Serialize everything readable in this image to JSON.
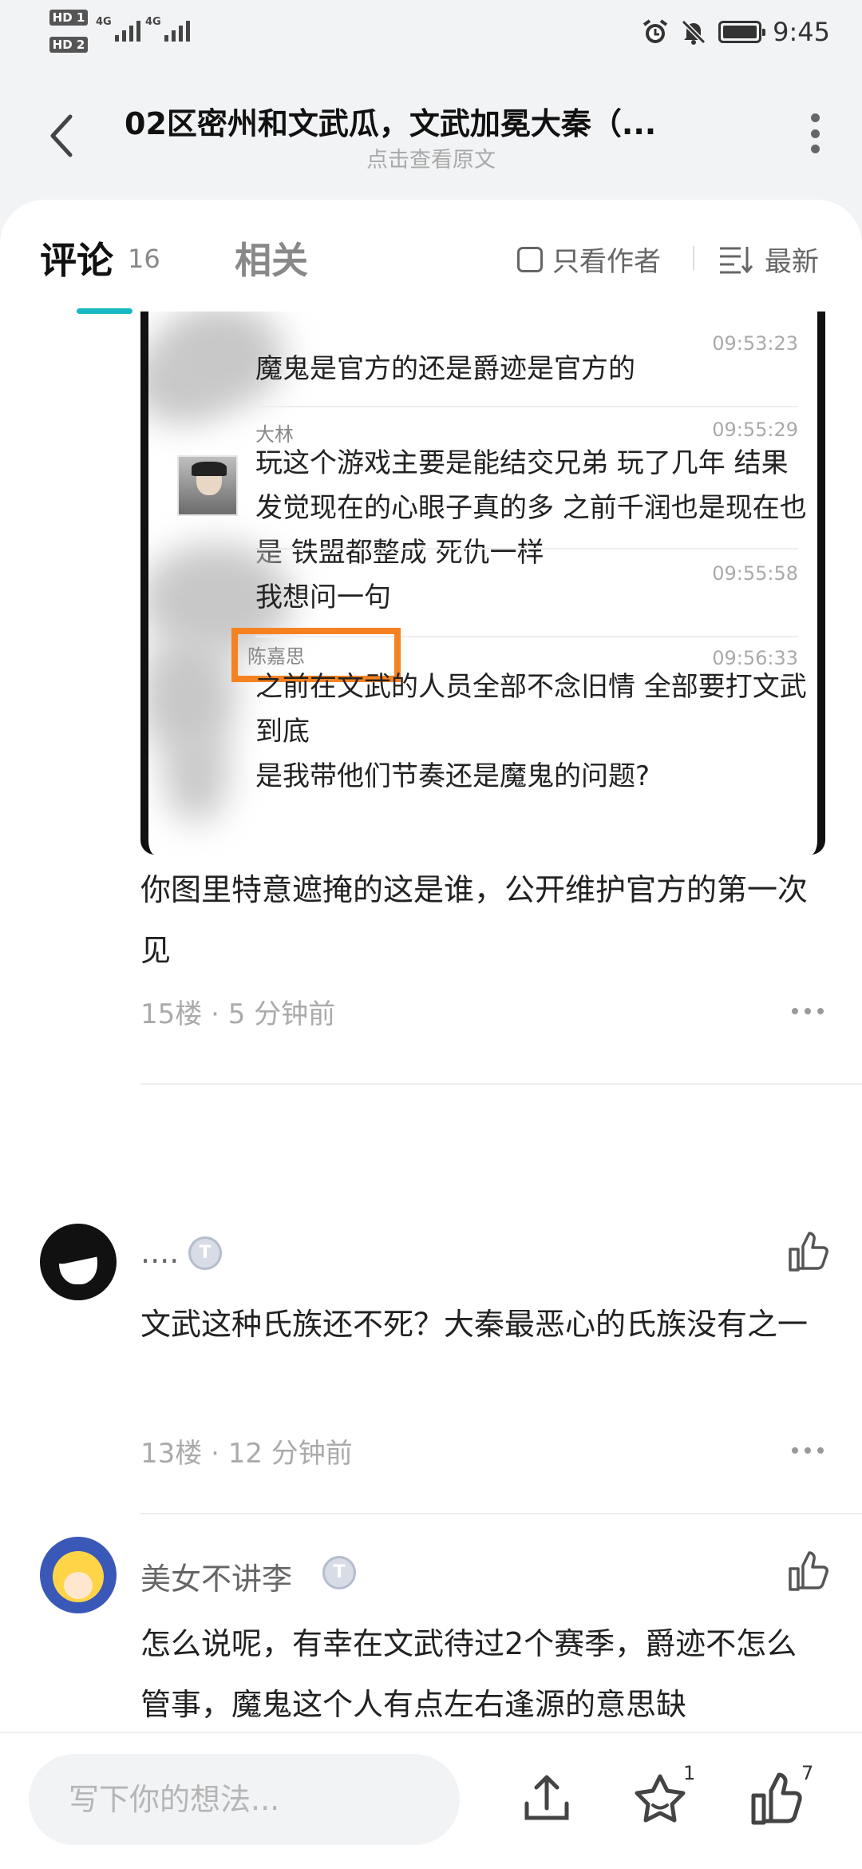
{
  "status_bar": {
    "sim1": "HD 1",
    "sim2": "HD 2",
    "network": "4G",
    "time": "9:45"
  },
  "header": {
    "title": "02区密州和文武瓜，文武加冕大秦（...",
    "subtitle": "点击查看原文"
  },
  "tabs": {
    "comments_label": "评论",
    "comments_count": "16",
    "related_label": "相关",
    "only_author_label": "只看作者",
    "sort_label": "最新"
  },
  "embedded_chat": {
    "messages": [
      {
        "name": "",
        "time": "09:53:23",
        "text": "魔鬼是官方的还是爵迹是官方的"
      },
      {
        "name": "大林",
        "time": "09:55:29",
        "text": "玩这个游戏主要是能结交兄弟 玩了几年 结果发觉现在的心眼子真的多 之前千润也是现在也是 铁盟都整成 死仇一样"
      },
      {
        "name": "",
        "time": "09:55:58",
        "text": "我想问一句"
      },
      {
        "name": "陈嘉思",
        "time": "09:56:33",
        "text": "之前在文武的人员全部不念旧情 全部要打文武到底\n是我带他们节奏还是魔鬼的问题?"
      }
    ]
  },
  "comments": [
    {
      "text": "你图里特意遮掩的这是谁，公开维护官方的第一次见",
      "floor": "15楼",
      "time": "5 分钟前"
    },
    {
      "username": "....",
      "badge": "T",
      "text": "文武这种氏族还不死？大秦最恶心的氏族没有之一",
      "floor": "13楼",
      "time": "12 分钟前"
    },
    {
      "username": "美女不讲李",
      "badge": "T",
      "text": "怎么说呢，有幸在文武待过2个赛季，爵迹不怎么管事，魔鬼这个人有点左右逢源的意思缺"
    }
  ],
  "bottom_bar": {
    "input_placeholder": "写下你的想法...",
    "favorite_count": "1",
    "like_count": "7"
  },
  "colors": {
    "accent": "#19b8c4",
    "highlight": "#f58220"
  },
  "icons": [
    "back-icon",
    "more-icon",
    "checkbox-icon",
    "sort-icon",
    "like-icon",
    "share-icon",
    "star-icon",
    "thumb-up-icon",
    "alarm-icon",
    "mute-icon",
    "battery-icon",
    "signal-icon"
  ]
}
